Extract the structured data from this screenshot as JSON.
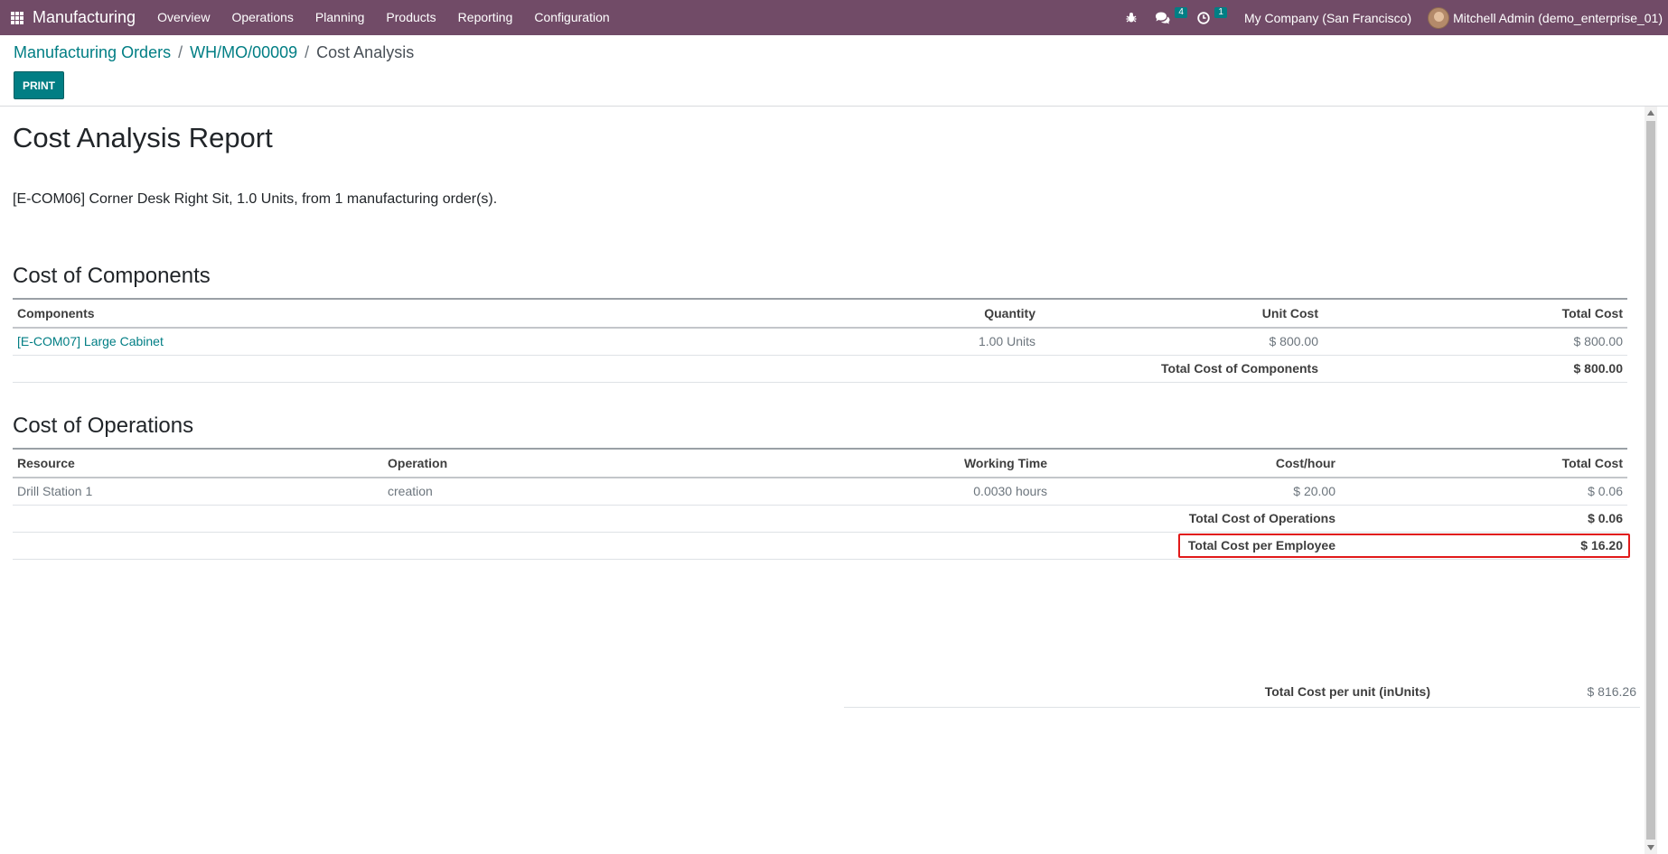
{
  "navbar": {
    "app_name": "Manufacturing",
    "menu": [
      "Overview",
      "Operations",
      "Planning",
      "Products",
      "Reporting",
      "Configuration"
    ],
    "messages_badge": "4",
    "activities_badge": "1",
    "company": "My Company (San Francisco)",
    "user": "Mitchell Admin (demo_enterprise_01)",
    "icons": [
      "apps-grid-icon",
      "bug-icon",
      "chat-icon",
      "clock-icon"
    ]
  },
  "breadcrumb": {
    "items": [
      "Manufacturing Orders",
      "WH/MO/00009"
    ],
    "current": "Cost Analysis",
    "separator": "/"
  },
  "print_label": "PRINT",
  "report": {
    "title": "Cost Analysis Report",
    "summary": "[E-COM06] Corner Desk Right Sit, 1.0 Units, from 1 manufacturing order(s).",
    "components": {
      "heading": "Cost of Components",
      "headers": [
        "Components",
        "Quantity",
        "Unit Cost",
        "Total Cost"
      ],
      "rows": [
        {
          "name": "[E-COM07] Large Cabinet",
          "quantity": "1.00 Units",
          "unit_cost": "$ 800.00",
          "total": "$ 800.00"
        }
      ],
      "total_label": "Total Cost of Components",
      "total_value": "$ 800.00"
    },
    "operations": {
      "heading": "Cost of Operations",
      "headers": [
        "Resource",
        "Operation",
        "Working Time",
        "Cost/hour",
        "Total Cost"
      ],
      "rows": [
        {
          "resource": "Drill Station 1",
          "operation": "creation",
          "time": "0.0030 hours",
          "cost_hour": "$ 20.00",
          "total": "$ 0.06"
        }
      ],
      "total_label": "Total Cost of Operations",
      "total_value": "$ 0.06",
      "employee_label": "Total Cost per Employee",
      "employee_value": "$ 16.20"
    },
    "unit_cost_label": "Total Cost per unit (inUnits)",
    "unit_cost_value": "$ 816.26"
  },
  "colors": {
    "navbar": "#714B67",
    "accent": "#017e84",
    "highlight": "#e11a1a"
  }
}
